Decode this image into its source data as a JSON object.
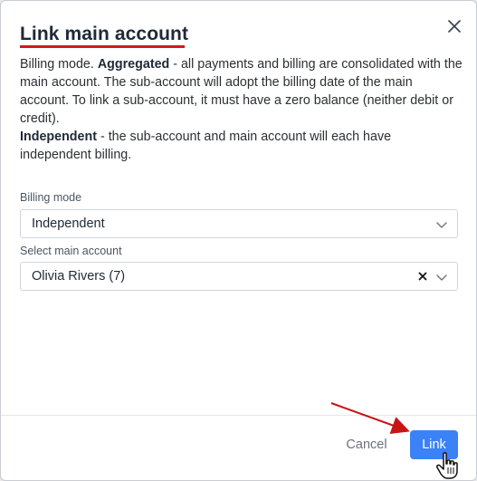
{
  "dialog": {
    "title": "Link main account",
    "description": {
      "intro": "Billing mode. ",
      "aggregated_label": "Aggregated",
      "aggregated_text": " - all payments and billing are consolidated with the main account. The sub-account will adopt the billing date of the main account. To link a sub-account, it must have a zero balance (neither debit or credit).",
      "independent_label": "Independent",
      "independent_text": " - the sub-account and main account will each have independent billing."
    }
  },
  "form": {
    "billing_mode": {
      "label": "Billing mode",
      "value": "Independent"
    },
    "main_account": {
      "label": "Select main account",
      "value": "Olivia Rivers (7)"
    }
  },
  "footer": {
    "cancel_label": "Cancel",
    "link_label": "Link"
  },
  "colors": {
    "accent": "#3b82f6",
    "title_underline": "#d11a1a",
    "annotation_arrow": "#c81414"
  },
  "icons": {
    "close": "close-icon",
    "chevron": "chevron-down-icon",
    "clear": "clear-icon",
    "cursor": "hand-pointer-icon"
  }
}
